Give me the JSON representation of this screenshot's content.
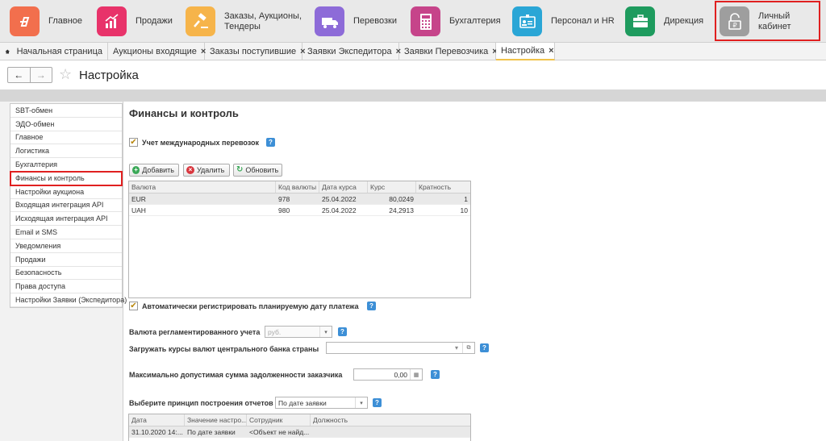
{
  "sections": [
    {
      "label": "Главное",
      "icon": "main-logo-icon",
      "color": "#f26f4d"
    },
    {
      "label": "Продажи",
      "icon": "sales-chart-icon",
      "color": "#e8336a"
    },
    {
      "label": "Заказы, Аукционы, Тендеры",
      "icon": "gavel-icon",
      "color": "#f6b44a"
    },
    {
      "label": "Перевозки",
      "icon": "truck-icon",
      "color": "#8d6bd8"
    },
    {
      "label": "Бухгалтерия",
      "icon": "calculator-icon",
      "color": "#c6448a"
    },
    {
      "label": "Персонал и HR",
      "icon": "badge-icon",
      "color": "#2aa6d6"
    },
    {
      "label": "Дирекция",
      "icon": "briefcase-icon",
      "color": "#1e9b5e"
    },
    {
      "label": "Личный кабинет",
      "icon": "lock-ruble-icon",
      "color": "#9e9e9e"
    }
  ],
  "tabs": [
    {
      "label": "Начальная страница"
    },
    {
      "label": "Аукционы входящие"
    },
    {
      "label": "Заказы поступившие"
    },
    {
      "label": "Заявки Экспедитора"
    },
    {
      "label": "Заявки Перевозчика"
    },
    {
      "label": "Настройка"
    }
  ],
  "tab_close": "×",
  "page": {
    "title": "Настройка"
  },
  "menu": [
    "SBT-обмен",
    "ЭДО-обмен",
    "Главное",
    "Логистика",
    "Бухгалтерия",
    "Финансы и контроль",
    "Настройки аукциона",
    "Входящая интеграция API",
    "Исходящая интеграция API",
    "Email и SMS",
    "Уведомления",
    "Продажи",
    "Безопасность",
    "Права доступа",
    "Настройки Заявки (Экспедитора)"
  ],
  "content": {
    "heading": "Финансы и контроль",
    "intl_label": "Учет международных перевозок",
    "buttons": {
      "add": "Добавить",
      "delete": "Удалить",
      "refresh": "Обновить"
    },
    "currency_table": {
      "columns": [
        "Валюта",
        "Код валюты",
        "Дата курса",
        "Курс",
        "Кратность"
      ],
      "rows": [
        [
          "EUR",
          "978",
          "25.04.2022",
          "80,0249",
          "1"
        ],
        [
          "UAH",
          "980",
          "25.04.2022",
          "24,2913",
          "10"
        ]
      ]
    },
    "auto_register_label": "Автоматически регистрировать планируемую дату платежа",
    "reg_currency_label": "Валюта регламентированного учета",
    "reg_currency_value": "руб.",
    "load_rates_label": "Загружать курсы валют центрального банка страны",
    "load_rates_value": "",
    "max_debt_label": "Максимально допустимая сумма задолженности заказчика",
    "max_debt_value": "0,00",
    "report_principle_label": "Выберите принцип построения отчетов",
    "report_principle_value": "По дате заявки",
    "history_table": {
      "columns": [
        "Дата",
        "Значение настро...",
        "Сотрудник",
        "Должность"
      ],
      "rows": [
        [
          "31.10.2020 14:...",
          "По дате заявки",
          "<Объект не найд...",
          ""
        ]
      ]
    }
  }
}
